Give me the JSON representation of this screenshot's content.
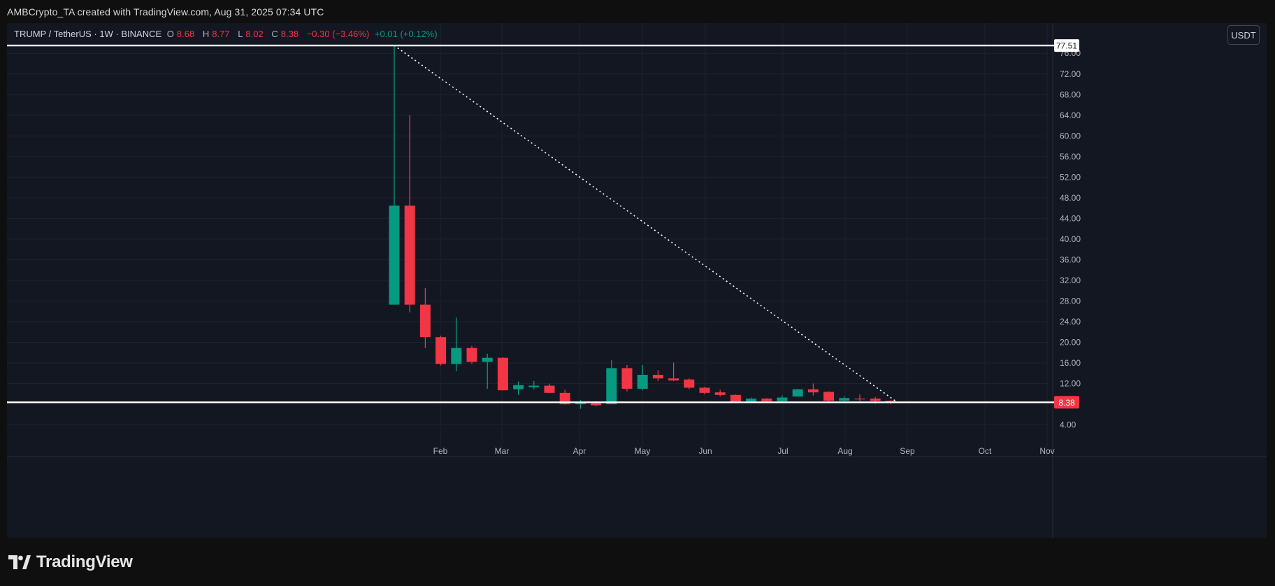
{
  "credit": "AMBCrypto_TA created with TradingView.com, Aug 31, 2025 07:34 UTC",
  "legend": {
    "symbol": "TRUMP / TetherUS · 1W · BINANCE",
    "o_label": "O",
    "o_value": "8.68",
    "h_label": "H",
    "h_value": "8.77",
    "l_label": "L",
    "l_value": "8.02",
    "c_label": "C",
    "c_value": "8.38",
    "change": "−0.30 (−3.46%)",
    "volume_change": "+0.01 (+0.12%)"
  },
  "currency_button": "USDT",
  "logo_text": "TradingView",
  "colors": {
    "up": "#089981",
    "down": "#f23645",
    "background": "#131722",
    "level_line": "#ffffff"
  },
  "chart_data": {
    "type": "candlestick",
    "title": "TRUMP / TetherUS · 1W · BINANCE",
    "y_axis": {
      "ticks": [
        "4.00",
        "12.00",
        "16.00",
        "20.00",
        "24.00",
        "28.00",
        "32.00",
        "36.00",
        "40.00",
        "44.00",
        "48.00",
        "52.00",
        "56.00",
        "60.00",
        "64.00",
        "68.00",
        "72.00",
        "76.00"
      ],
      "range": [
        0,
        80
      ]
    },
    "x_axis": {
      "tick_labels": [
        "Feb",
        "Mar",
        "Apr",
        "May",
        "Jun",
        "Jul",
        "Aug",
        "Sep",
        "Oct",
        "Nov"
      ]
    },
    "price_labels": [
      {
        "value": 77.51,
        "text": "77.51",
        "style": "white"
      },
      {
        "value": 8.38,
        "text": "8.38",
        "style": "red"
      }
    ],
    "horizontal_levels": [
      77.51,
      8.38
    ],
    "trendline": {
      "style": "dotted",
      "from": {
        "week": 0,
        "price": 77.51
      },
      "to": {
        "week": 32,
        "price": 8.5
      }
    },
    "candles": [
      {
        "o": 27.3,
        "h": 77.51,
        "l": 27.3,
        "c": 46.5
      },
      {
        "o": 46.5,
        "h": 64.0,
        "l": 25.8,
        "c": 27.3
      },
      {
        "o": 27.3,
        "h": 30.5,
        "l": 18.9,
        "c": 21.0
      },
      {
        "o": 21.0,
        "h": 21.3,
        "l": 15.5,
        "c": 15.8
      },
      {
        "o": 15.8,
        "h": 24.8,
        "l": 14.4,
        "c": 18.9
      },
      {
        "o": 18.9,
        "h": 19.3,
        "l": 15.8,
        "c": 16.2
      },
      {
        "o": 16.2,
        "h": 17.8,
        "l": 11.0,
        "c": 17.0
      },
      {
        "o": 17.0,
        "h": 17.1,
        "l": 10.7,
        "c": 10.7
      },
      {
        "o": 10.9,
        "h": 12.4,
        "l": 9.8,
        "c": 11.7
      },
      {
        "o": 11.3,
        "h": 12.5,
        "l": 10.9,
        "c": 11.6
      },
      {
        "o": 11.6,
        "h": 12.0,
        "l": 10.3,
        "c": 10.2
      },
      {
        "o": 10.2,
        "h": 10.8,
        "l": 7.9,
        "c": 8.0
      },
      {
        "o": 8.0,
        "h": 8.8,
        "l": 7.1,
        "c": 8.2
      },
      {
        "o": 8.2,
        "h": 8.6,
        "l": 7.6,
        "c": 7.8
      },
      {
        "o": 8.0,
        "h": 16.6,
        "l": 8.0,
        "c": 15.0
      },
      {
        "o": 15.0,
        "h": 15.6,
        "l": 10.5,
        "c": 11.0
      },
      {
        "o": 11.0,
        "h": 15.6,
        "l": 10.7,
        "c": 13.7
      },
      {
        "o": 13.7,
        "h": 14.6,
        "l": 12.5,
        "c": 13.0
      },
      {
        "o": 13.0,
        "h": 16.1,
        "l": 12.5,
        "c": 12.6
      },
      {
        "o": 12.8,
        "h": 13.0,
        "l": 10.9,
        "c": 11.2
      },
      {
        "o": 11.2,
        "h": 11.4,
        "l": 9.9,
        "c": 10.2
      },
      {
        "o": 10.3,
        "h": 10.8,
        "l": 9.5,
        "c": 9.8
      },
      {
        "o": 9.8,
        "h": 9.9,
        "l": 8.2,
        "c": 8.4
      },
      {
        "o": 8.5,
        "h": 9.3,
        "l": 8.3,
        "c": 9.1
      },
      {
        "o": 9.1,
        "h": 9.2,
        "l": 8.4,
        "c": 8.6
      },
      {
        "o": 8.6,
        "h": 9.7,
        "l": 8.4,
        "c": 9.3
      },
      {
        "o": 9.5,
        "h": 11.0,
        "l": 9.5,
        "c": 10.9
      },
      {
        "o": 10.9,
        "h": 12.0,
        "l": 9.7,
        "c": 10.3
      },
      {
        "o": 10.4,
        "h": 10.5,
        "l": 8.5,
        "c": 8.7
      },
      {
        "o": 8.7,
        "h": 9.5,
        "l": 8.5,
        "c": 9.2
      },
      {
        "o": 9.1,
        "h": 9.9,
        "l": 8.6,
        "c": 9.0
      },
      {
        "o": 9.1,
        "h": 9.4,
        "l": 8.1,
        "c": 8.68
      },
      {
        "o": 8.68,
        "h": 8.77,
        "l": 8.02,
        "c": 8.38
      }
    ]
  }
}
